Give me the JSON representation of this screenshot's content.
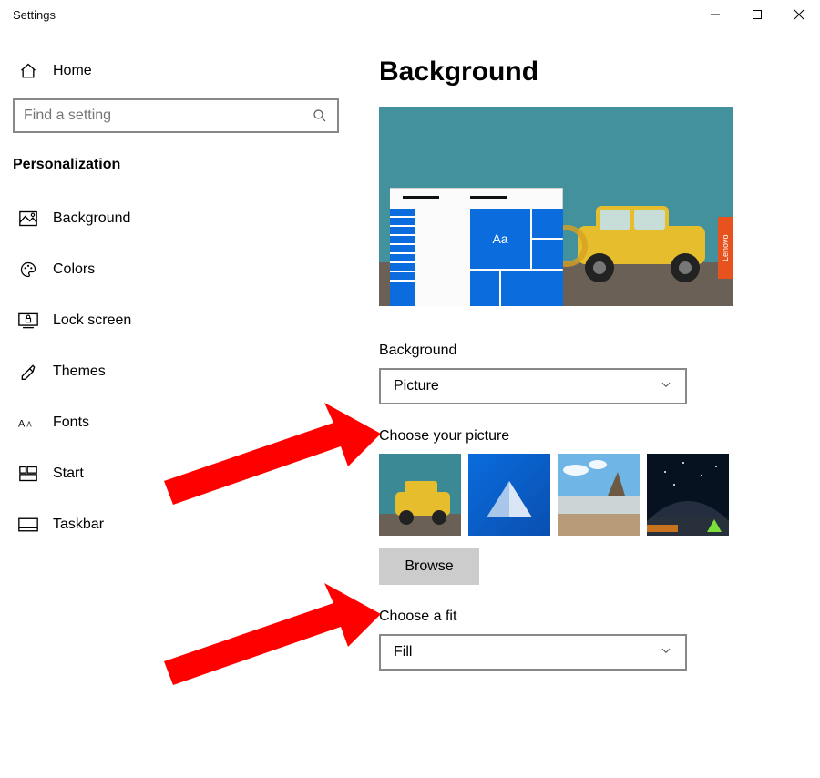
{
  "titlebar": {
    "title": "Settings"
  },
  "sidebar": {
    "home_label": "Home",
    "search_placeholder": "Find a setting",
    "section_title": "Personalization",
    "items": [
      {
        "label": "Background"
      },
      {
        "label": "Colors"
      },
      {
        "label": "Lock screen"
      },
      {
        "label": "Themes"
      },
      {
        "label": "Fonts"
      },
      {
        "label": "Start"
      },
      {
        "label": "Taskbar"
      }
    ]
  },
  "main": {
    "title": "Background",
    "preview_aa": "Aa",
    "preview_brand": "Lenovo",
    "background_label": "Background",
    "background_value": "Picture",
    "choose_picture_label": "Choose your picture",
    "browse_label": "Browse",
    "fit_label": "Choose a fit",
    "fit_value": "Fill"
  },
  "colors": {
    "blue": "#0a6cdd",
    "orange": "#e8521e",
    "teal": "#3b8994",
    "yellow": "#e6bd2d"
  }
}
